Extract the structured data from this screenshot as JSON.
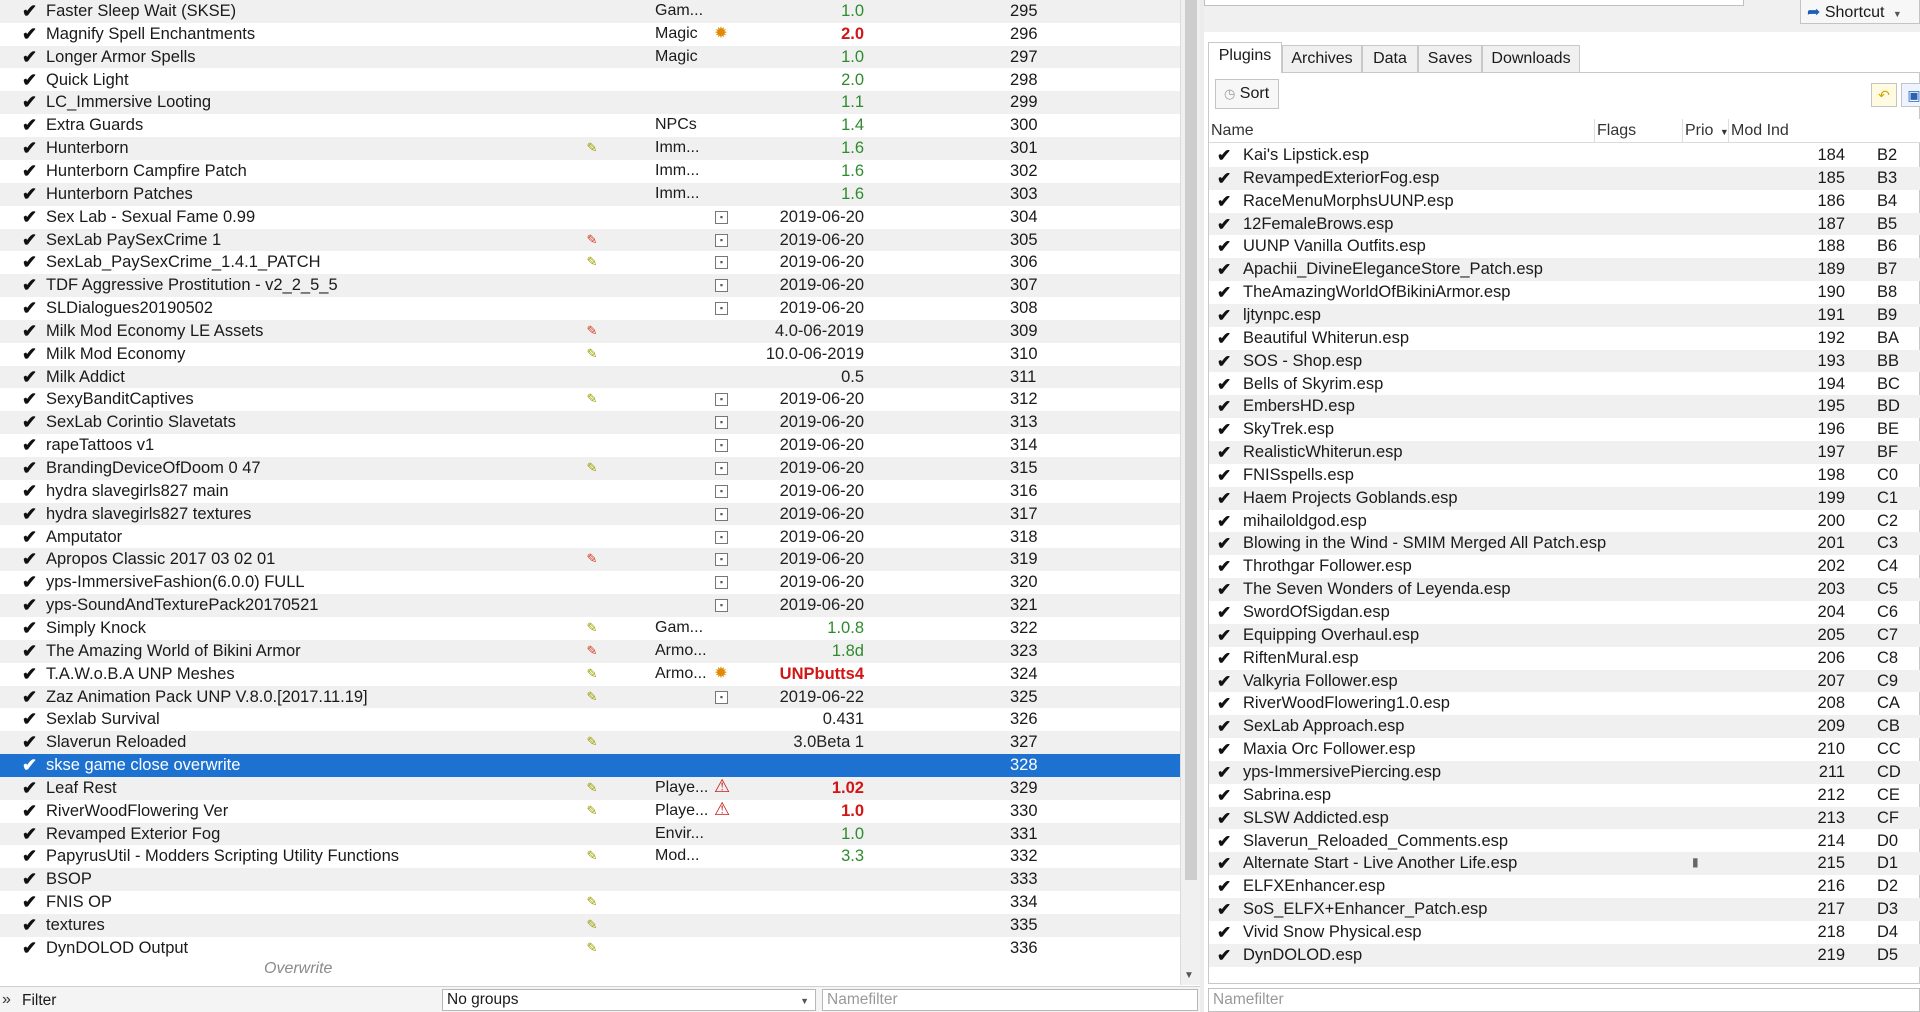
{
  "mod_list": {
    "rows": [
      {
        "check": "✔",
        "name": "Faster Sleep Wait (SKSE)",
        "flag": "",
        "category": "Gam...",
        "cicon": "",
        "version": "1.0",
        "vclass": "green",
        "priority": "295"
      },
      {
        "check": "✔",
        "name": "Magnify Spell Enchantments",
        "flag": "",
        "category": "Magic",
        "cicon": "gear",
        "version": "2.0",
        "vclass": "red",
        "priority": "296"
      },
      {
        "check": "✔",
        "name": "Longer Armor Spells",
        "flag": "",
        "category": "Magic",
        "cicon": "",
        "version": "1.0",
        "vclass": "green",
        "priority": "297"
      },
      {
        "check": "✔",
        "name": "Quick Light",
        "flag": "",
        "category": "",
        "cicon": "",
        "version": "2.0",
        "vclass": "green",
        "priority": "298"
      },
      {
        "check": "✔",
        "name": "LC_Immersive Looting",
        "flag": "",
        "category": "",
        "cicon": "",
        "version": "1.1",
        "vclass": "green",
        "priority": "299"
      },
      {
        "check": "✔",
        "name": "Extra Guards",
        "flag": "",
        "category": "NPCs",
        "cicon": "",
        "version": "1.4",
        "vclass": "green",
        "priority": "300"
      },
      {
        "check": "✔",
        "name": "Hunterborn",
        "flag": "y",
        "category": "Imm...",
        "cicon": "",
        "version": "1.6",
        "vclass": "green",
        "priority": "301"
      },
      {
        "check": "✔",
        "name": "Hunterborn Campfire Patch",
        "flag": "",
        "category": "Imm...",
        "cicon": "",
        "version": "1.6",
        "vclass": "green",
        "priority": "302"
      },
      {
        "check": "✔",
        "name": "Hunterborn Patches",
        "flag": "",
        "category": "Imm...",
        "cicon": "",
        "version": "1.6",
        "vclass": "green",
        "priority": "303"
      },
      {
        "check": "✔",
        "name": "Sex Lab - Sexual Fame 0.99",
        "flag": "",
        "category": "",
        "cicon": "ctl",
        "version": "2019-06-20",
        "vclass": "dark",
        "priority": "304"
      },
      {
        "check": "✔",
        "name": "SexLab PaySexCrime 1",
        "flag": "r",
        "category": "",
        "cicon": "ctl",
        "version": "2019-06-20",
        "vclass": "dark",
        "priority": "305"
      },
      {
        "check": "✔",
        "name": "SexLab_PaySexCrime_1.4.1_PATCH",
        "flag": "y",
        "category": "",
        "cicon": "ctl",
        "version": "2019-06-20",
        "vclass": "dark",
        "priority": "306"
      },
      {
        "check": "✔",
        "name": "TDF Aggressive Prostitution - v2_2_5_5",
        "flag": "",
        "category": "",
        "cicon": "ctl",
        "version": "2019-06-20",
        "vclass": "dark",
        "priority": "307"
      },
      {
        "check": "✔",
        "name": "SLDialogues20190502",
        "flag": "",
        "category": "",
        "cicon": "ctl",
        "version": "2019-06-20",
        "vclass": "dark",
        "priority": "308"
      },
      {
        "check": "✔",
        "name": "Milk Mod Economy LE Assets",
        "flag": "r",
        "category": "",
        "cicon": "",
        "version": "4.0-06-2019",
        "vclass": "dark",
        "priority": "309"
      },
      {
        "check": "✔",
        "name": "Milk Mod Economy",
        "flag": "y",
        "category": "",
        "cicon": "",
        "version": "10.0-06-2019",
        "vclass": "dark",
        "priority": "310"
      },
      {
        "check": "✔",
        "name": "Milk Addict",
        "flag": "",
        "category": "",
        "cicon": "",
        "version": "0.5",
        "vclass": "dark",
        "priority": "311"
      },
      {
        "check": "✔",
        "name": "SexyBanditCaptives",
        "flag": "y",
        "category": "",
        "cicon": "ctl",
        "version": "2019-06-20",
        "vclass": "dark",
        "priority": "312"
      },
      {
        "check": "✔",
        "name": "SexLab Corintio Slavetats",
        "flag": "",
        "category": "",
        "cicon": "ctl",
        "version": "2019-06-20",
        "vclass": "dark",
        "priority": "313"
      },
      {
        "check": "✔",
        "name": "rapeTattoos v1",
        "flag": "",
        "category": "",
        "cicon": "ctl",
        "version": "2019-06-20",
        "vclass": "dark",
        "priority": "314"
      },
      {
        "check": "✔",
        "name": "BrandingDeviceOfDoom 0 47",
        "flag": "y",
        "category": "",
        "cicon": "ctl",
        "version": "2019-06-20",
        "vclass": "dark",
        "priority": "315"
      },
      {
        "check": "✔",
        "name": "hydra slavegirls827 main",
        "flag": "",
        "category": "",
        "cicon": "ctl",
        "version": "2019-06-20",
        "vclass": "dark",
        "priority": "316"
      },
      {
        "check": "✔",
        "name": "hydra slavegirls827 textures",
        "flag": "",
        "category": "",
        "cicon": "ctl",
        "version": "2019-06-20",
        "vclass": "dark",
        "priority": "317"
      },
      {
        "check": "✔",
        "name": "Amputator",
        "flag": "",
        "category": "",
        "cicon": "ctl",
        "version": "2019-06-20",
        "vclass": "dark",
        "priority": "318"
      },
      {
        "check": "✔",
        "name": "Apropos Classic 2017 03 02 01",
        "flag": "r",
        "category": "",
        "cicon": "ctl",
        "version": "2019-06-20",
        "vclass": "dark",
        "priority": "319"
      },
      {
        "check": "✔",
        "name": "yps-ImmersiveFashion(6.0.0) FULL",
        "flag": "",
        "category": "",
        "cicon": "ctl",
        "version": "2019-06-20",
        "vclass": "dark",
        "priority": "320"
      },
      {
        "check": "✔",
        "name": "yps-SoundAndTexturePack20170521",
        "flag": "",
        "category": "",
        "cicon": "ctl",
        "version": "2019-06-20",
        "vclass": "dark",
        "priority": "321"
      },
      {
        "check": "✔",
        "name": "Simply Knock",
        "flag": "y",
        "category": "Gam...",
        "cicon": "",
        "version": "1.0.8",
        "vclass": "green",
        "priority": "322"
      },
      {
        "check": "✔",
        "name": "The Amazing World of Bikini Armor",
        "flag": "r",
        "category": "Armo...",
        "cicon": "",
        "version": "1.8d",
        "vclass": "green",
        "priority": "323"
      },
      {
        "check": "✔",
        "name": "T.A.W.o.B.A UNP Meshes",
        "flag": "y",
        "category": "Armo...",
        "cicon": "gear",
        "version": "UNPbutts4",
        "vclass": "red",
        "priority": "324"
      },
      {
        "check": "✔",
        "name": "Zaz Animation Pack UNP V.8.0.[2017.11.19]",
        "flag": "y",
        "category": "",
        "cicon": "ctl",
        "version": "2019-06-22",
        "vclass": "dark",
        "priority": "325"
      },
      {
        "check": "✔",
        "name": "Sexlab Survival",
        "flag": "",
        "category": "",
        "cicon": "",
        "version": "0.431",
        "vclass": "dark",
        "priority": "326"
      },
      {
        "check": "✔",
        "name": "Slaverun Reloaded",
        "flag": "y",
        "category": "",
        "cicon": "",
        "version": "3.0Beta 1",
        "vclass": "dark",
        "priority": "327"
      },
      {
        "check": "✔",
        "name": "skse game close overwrite",
        "flag": "",
        "category": "",
        "cicon": "",
        "version": "",
        "vclass": "dark",
        "priority": "328",
        "selected": true
      },
      {
        "check": "✔",
        "name": "Leaf Rest",
        "flag": "y",
        "category": "Playe...",
        "cicon": "warn",
        "version": "1.02",
        "vclass": "red",
        "priority": "329"
      },
      {
        "check": "✔",
        "name": "RiverWoodFlowering Ver",
        "flag": "y",
        "category": "Playe...",
        "cicon": "warn",
        "version": "1.0",
        "vclass": "red",
        "priority": "330"
      },
      {
        "check": "✔",
        "name": "Revamped Exterior Fog",
        "flag": "",
        "category": "Envir...",
        "cicon": "",
        "version": "1.0",
        "vclass": "green",
        "priority": "331"
      },
      {
        "check": "✔",
        "name": "PapyrusUtil - Modders Scripting Utility Functions",
        "flag": "y",
        "category": "Mod...",
        "cicon": "",
        "version": "3.3",
        "vclass": "green",
        "priority": "332"
      },
      {
        "check": "✔",
        "name": "BSOP",
        "flag": "",
        "category": "",
        "cicon": "",
        "version": "",
        "vclass": "dark",
        "priority": "333"
      },
      {
        "check": "✔",
        "name": "FNIS OP",
        "flag": "y",
        "category": "",
        "cicon": "",
        "version": "",
        "vclass": "dark",
        "priority": "334"
      },
      {
        "check": "✔",
        "name": "textures",
        "flag": "y",
        "category": "",
        "cicon": "",
        "version": "",
        "vclass": "dark",
        "priority": "335"
      },
      {
        "check": "✔",
        "name": "DynDOLOD Output",
        "flag": "y",
        "category": "",
        "cicon": "",
        "version": "",
        "vclass": "dark",
        "priority": "336"
      }
    ],
    "overwrite_label": "Overwrite"
  },
  "filter_bar": {
    "toggle": "»",
    "filter_label": "Filter",
    "groups_value": "No groups",
    "namefilter_placeholder": "Namefilter"
  },
  "right_pane": {
    "shortcut_label": "Shortcut",
    "tabs": [
      "Plugins",
      "Archives",
      "Data",
      "Saves",
      "Downloads"
    ],
    "active_tab": "Plugins",
    "sort_label": "Sort",
    "headers": {
      "name": "Name",
      "flags": "Flags",
      "prio": "Prio",
      "mod_index": "Mod Ind"
    },
    "plugins": [
      {
        "check": "✔",
        "name": "Kai's Lipstick.esp",
        "prio": "184",
        "idx": "B2"
      },
      {
        "check": "✔",
        "name": "RevampedExteriorFog.esp",
        "prio": "185",
        "idx": "B3"
      },
      {
        "check": "✔",
        "name": "RaceMenuMorphsUUNP.esp",
        "prio": "186",
        "idx": "B4"
      },
      {
        "check": "✔",
        "name": "12FemaleBrows.esp",
        "prio": "187",
        "idx": "B5"
      },
      {
        "check": "✔",
        "name": "UUNP Vanilla Outfits.esp",
        "prio": "188",
        "idx": "B6"
      },
      {
        "check": "✔",
        "name": "Apachii_DivineEleganceStore_Patch.esp",
        "prio": "189",
        "idx": "B7"
      },
      {
        "check": "✔",
        "name": "TheAmazingWorldOfBikiniArmor.esp",
        "prio": "190",
        "idx": "B8"
      },
      {
        "check": "✔",
        "name": "ljtynpc.esp",
        "prio": "191",
        "idx": "B9"
      },
      {
        "check": "✔",
        "name": "Beautiful Whiterun.esp",
        "prio": "192",
        "idx": "BA"
      },
      {
        "check": "✔",
        "name": "SOS - Shop.esp",
        "prio": "193",
        "idx": "BB"
      },
      {
        "check": "✔",
        "name": "Bells of Skyrim.esp",
        "prio": "194",
        "idx": "BC"
      },
      {
        "check": "✔",
        "name": "EmbersHD.esp",
        "prio": "195",
        "idx": "BD"
      },
      {
        "check": "✔",
        "name": "SkyTrek.esp",
        "prio": "196",
        "idx": "BE"
      },
      {
        "check": "✔",
        "name": "RealisticWhiterun.esp",
        "prio": "197",
        "idx": "BF"
      },
      {
        "check": "✔",
        "name": "FNISspells.esp",
        "prio": "198",
        "idx": "C0"
      },
      {
        "check": "✔",
        "name": "Haem Projects Goblands.esp",
        "prio": "199",
        "idx": "C1"
      },
      {
        "check": "✔",
        "name": "mihailoldgod.esp",
        "prio": "200",
        "idx": "C2"
      },
      {
        "check": "✔",
        "name": "Blowing in the Wind - SMIM Merged All Patch.esp",
        "prio": "201",
        "idx": "C3"
      },
      {
        "check": "✔",
        "name": "Throthgar Follower.esp",
        "prio": "202",
        "idx": "C4"
      },
      {
        "check": "✔",
        "name": "The Seven Wonders of Leyenda.esp",
        "prio": "203",
        "idx": "C5"
      },
      {
        "check": "✔",
        "name": "SwordOfSigdan.esp",
        "prio": "204",
        "idx": "C6"
      },
      {
        "check": "✔",
        "name": "Equipping Overhaul.esp",
        "prio": "205",
        "idx": "C7"
      },
      {
        "check": "✔",
        "name": "RiftenMural.esp",
        "prio": "206",
        "idx": "C8"
      },
      {
        "check": "✔",
        "name": "Valkyria Follower.esp",
        "prio": "207",
        "idx": "C9"
      },
      {
        "check": "✔",
        "name": "RiverWoodFlowering1.0.esp",
        "prio": "208",
        "idx": "CA"
      },
      {
        "check": "✔",
        "name": "SexLab Approach.esp",
        "prio": "209",
        "idx": "CB"
      },
      {
        "check": "✔",
        "name": "Maxia Orc Follower.esp",
        "prio": "210",
        "idx": "CC"
      },
      {
        "check": "✔",
        "name": "yps-ImmersivePiercing.esp",
        "prio": "211",
        "idx": "CD"
      },
      {
        "check": "✔",
        "name": "Sabrina.esp",
        "prio": "212",
        "idx": "CE"
      },
      {
        "check": "✔",
        "name": "SLSW Addicted.esp",
        "prio": "213",
        "idx": "CF"
      },
      {
        "check": "✔",
        "name": "Slaverun_Reloaded_Comments.esp",
        "prio": "214",
        "idx": "D0"
      },
      {
        "check": "✔",
        "name": "Alternate Start - Live Another Life.esp",
        "prio": "215",
        "idx": "D1",
        "flag": true
      },
      {
        "check": "✔",
        "name": "ELFXEnhancer.esp",
        "prio": "216",
        "idx": "D2"
      },
      {
        "check": "✔",
        "name": "SoS_ELFX+Enhancer_Patch.esp",
        "prio": "217",
        "idx": "D3"
      },
      {
        "check": "✔",
        "name": "Vivid Snow Physical.esp",
        "prio": "218",
        "idx": "D4"
      },
      {
        "check": "✔",
        "name": "DynDOLOD.esp",
        "prio": "219",
        "idx": "D5"
      }
    ],
    "namefilter_placeholder": "Namefilter"
  }
}
